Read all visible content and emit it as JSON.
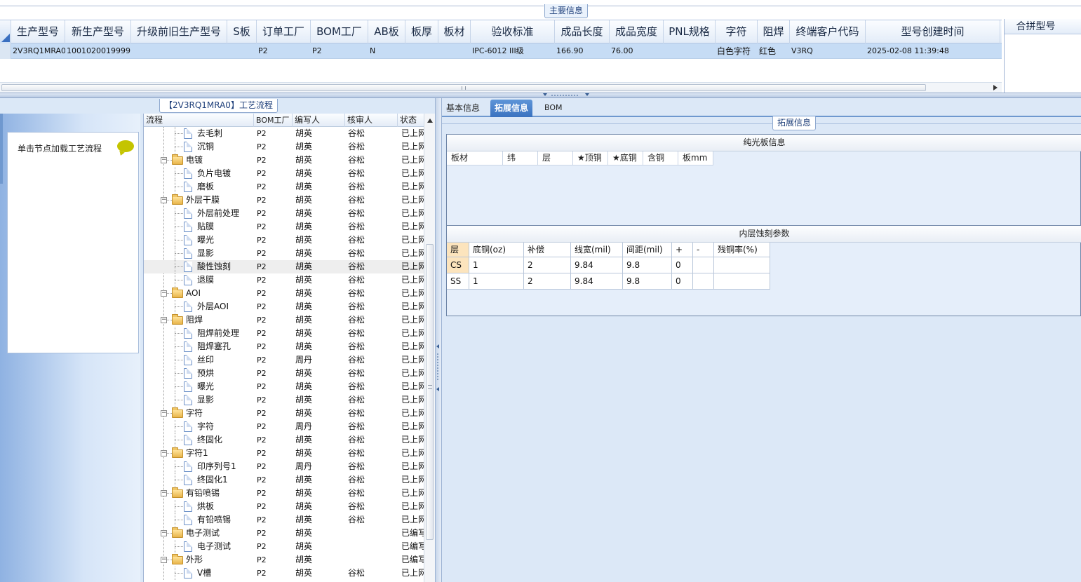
{
  "main_section_label": "主要信息",
  "grid": {
    "headers": [
      "生产型号",
      "新生产型号",
      "升级前旧生产型号",
      "S板",
      "订单工厂",
      "BOM工厂",
      "AB板",
      "板厚",
      "板材",
      "验收标准",
      "成品长度",
      "成品宽度",
      "PNL规格",
      "字符",
      "阻焊",
      "终端客户代码",
      "型号创建时间"
    ],
    "row": [
      "2V3RQ1MRA0",
      "10010200199991",
      "",
      "",
      "P2",
      "P2",
      "N",
      "",
      "",
      "IPC-6012 III级",
      "166.90",
      "76.00",
      "",
      "白色字符",
      "红色",
      "V3RQ",
      "2025-02-08 11:39:48"
    ]
  },
  "merge": {
    "header": "合拼型号"
  },
  "flow": {
    "tab_label": "【2V3RQ1MRA0】工艺流程",
    "hint": "单击节点加载工艺流程",
    "columns": [
      "流程",
      "BOM工厂",
      "编写人",
      "核审人",
      "状态"
    ],
    "rows": [
      {
        "name": "去毛刺",
        "type": "doc",
        "bom": "P2",
        "author": "胡英",
        "reviewer": "谷松",
        "status": "已上网"
      },
      {
        "name": "沉铜",
        "type": "doc",
        "bom": "P2",
        "author": "胡英",
        "reviewer": "谷松",
        "status": "已上网"
      },
      {
        "name": "电镀",
        "type": "folder",
        "bom": "P2",
        "author": "胡英",
        "reviewer": "谷松",
        "status": "已上网"
      },
      {
        "name": "负片电镀",
        "type": "doc",
        "bom": "P2",
        "author": "胡英",
        "reviewer": "谷松",
        "status": "已上网"
      },
      {
        "name": "磨板",
        "type": "doc",
        "bom": "P2",
        "author": "胡英",
        "reviewer": "谷松",
        "status": "已上网"
      },
      {
        "name": "外层干膜",
        "type": "folder",
        "bom": "P2",
        "author": "胡英",
        "reviewer": "谷松",
        "status": "已上网"
      },
      {
        "name": "外层前处理",
        "type": "doc",
        "bom": "P2",
        "author": "胡英",
        "reviewer": "谷松",
        "status": "已上网"
      },
      {
        "name": "贴膜",
        "type": "doc",
        "bom": "P2",
        "author": "胡英",
        "reviewer": "谷松",
        "status": "已上网"
      },
      {
        "name": "曝光",
        "type": "doc",
        "bom": "P2",
        "author": "胡英",
        "reviewer": "谷松",
        "status": "已上网"
      },
      {
        "name": "显影",
        "type": "doc",
        "bom": "P2",
        "author": "胡英",
        "reviewer": "谷松",
        "status": "已上网"
      },
      {
        "name": "酸性蚀刻",
        "type": "doc",
        "bom": "P2",
        "author": "胡英",
        "reviewer": "谷松",
        "status": "已上网",
        "selected": true
      },
      {
        "name": "退膜",
        "type": "doc",
        "bom": "P2",
        "author": "胡英",
        "reviewer": "谷松",
        "status": "已上网"
      },
      {
        "name": "AOI",
        "type": "folder",
        "bom": "P2",
        "author": "胡英",
        "reviewer": "谷松",
        "status": "已上网"
      },
      {
        "name": "外层AOI",
        "type": "doc",
        "bom": "P2",
        "author": "胡英",
        "reviewer": "谷松",
        "status": "已上网"
      },
      {
        "name": "阻焊",
        "type": "folder",
        "bom": "P2",
        "author": "胡英",
        "reviewer": "谷松",
        "status": "已上网"
      },
      {
        "name": "阻焊前处理",
        "type": "doc",
        "bom": "P2",
        "author": "胡英",
        "reviewer": "谷松",
        "status": "已上网"
      },
      {
        "name": "阻焊塞孔",
        "type": "doc",
        "bom": "P2",
        "author": "胡英",
        "reviewer": "谷松",
        "status": "已上网"
      },
      {
        "name": "丝印",
        "type": "doc",
        "bom": "P2",
        "author": "周丹",
        "reviewer": "谷松",
        "status": "已上网"
      },
      {
        "name": "预烘",
        "type": "doc",
        "bom": "P2",
        "author": "胡英",
        "reviewer": "谷松",
        "status": "已上网"
      },
      {
        "name": "曝光",
        "type": "doc",
        "bom": "P2",
        "author": "胡英",
        "reviewer": "谷松",
        "status": "已上网"
      },
      {
        "name": "显影",
        "type": "doc",
        "bom": "P2",
        "author": "胡英",
        "reviewer": "谷松",
        "status": "已上网"
      },
      {
        "name": "字符",
        "type": "folder",
        "bom": "P2",
        "author": "胡英",
        "reviewer": "谷松",
        "status": "已上网"
      },
      {
        "name": "字符",
        "type": "doc",
        "bom": "P2",
        "author": "周丹",
        "reviewer": "谷松",
        "status": "已上网"
      },
      {
        "name": "终固化",
        "type": "doc",
        "bom": "P2",
        "author": "胡英",
        "reviewer": "谷松",
        "status": "已上网"
      },
      {
        "name": "字符1",
        "type": "folder",
        "bom": "P2",
        "author": "胡英",
        "reviewer": "谷松",
        "status": "已上网"
      },
      {
        "name": "印序列号1",
        "type": "doc",
        "bom": "P2",
        "author": "周丹",
        "reviewer": "谷松",
        "status": "已上网"
      },
      {
        "name": "终固化1",
        "type": "doc",
        "bom": "P2",
        "author": "胡英",
        "reviewer": "谷松",
        "status": "已上网"
      },
      {
        "name": "有铅喷锡",
        "type": "folder",
        "bom": "P2",
        "author": "胡英",
        "reviewer": "谷松",
        "status": "已上网"
      },
      {
        "name": "烘板",
        "type": "doc",
        "bom": "P2",
        "author": "胡英",
        "reviewer": "谷松",
        "status": "已上网"
      },
      {
        "name": "有铅喷锡",
        "type": "doc",
        "bom": "P2",
        "author": "胡英",
        "reviewer": "谷松",
        "status": "已上网"
      },
      {
        "name": "电子测试",
        "type": "folder",
        "bom": "P2",
        "author": "胡英",
        "reviewer": "",
        "status": "已编写"
      },
      {
        "name": "电子测试",
        "type": "doc",
        "bom": "P2",
        "author": "胡英",
        "reviewer": "",
        "status": "已编写"
      },
      {
        "name": "外形",
        "type": "folder",
        "bom": "P2",
        "author": "胡英",
        "reviewer": "",
        "status": "已编写"
      },
      {
        "name": "V槽",
        "type": "doc",
        "bom": "P2",
        "author": "胡英",
        "reviewer": "谷松",
        "status": "已上网"
      }
    ]
  },
  "tabs": [
    "基本信息",
    "拓展信息",
    "BOM"
  ],
  "ext": {
    "section_label": "拓展信息",
    "plain_board_title": "纯光板信息",
    "plain_board_columns": [
      "板材",
      "纬",
      "层",
      "★顶铜",
      "★底铜",
      "含铜",
      "板mm"
    ],
    "inner_etch_title": "内层蚀刻参数",
    "inner_etch_columns": [
      "层",
      "底铜(oz)",
      "补偿",
      "线宽(mil)",
      "间距(mil)",
      "+",
      "-",
      "残铜率(%)"
    ],
    "inner_etch_rows": [
      [
        "CS",
        "1",
        "2",
        "9.84",
        "9.8",
        "0",
        "",
        ""
      ],
      [
        "SS",
        "1",
        "2",
        "9.84",
        "9.8",
        "0",
        "",
        ""
      ]
    ]
  },
  "colors": {
    "accent": "#3a72c0",
    "selected_row": "#c6dcf5",
    "layer_cell": "#fce4bd"
  }
}
